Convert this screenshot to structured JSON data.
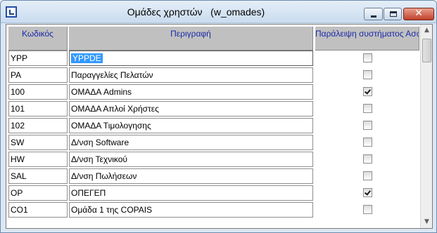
{
  "window": {
    "title": "Ομάδες χρηστών   (w_omades)",
    "close_glyph": "✕"
  },
  "grid": {
    "columns": {
      "code": "Κωδικός",
      "description": "Περιγραφή",
      "skip_security": "Παράλειψη συστήματος Ασφάλειας"
    },
    "rows": [
      {
        "code": "YPP",
        "description": "YPPDE",
        "skip_security": false
      },
      {
        "code": "PA",
        "description": "Παραγγελίες Πελατών",
        "skip_security": false
      },
      {
        "code": "100",
        "description": "ΟΜΑΔΑ Admins",
        "skip_security": true
      },
      {
        "code": "101",
        "description": "ΟΜΑΔΑ Απλοί Χρήστες",
        "skip_security": false
      },
      {
        "code": "102",
        "description": "ΟΜΑΔΑ Τιμολογησης",
        "skip_security": false
      },
      {
        "code": "SW",
        "description": "Δ/νση Software",
        "skip_security": false
      },
      {
        "code": "HW",
        "description": "Δ/νση Τεχνικού",
        "skip_security": false
      },
      {
        "code": "SAL",
        "description": "Δ/νση Πωλήσεων",
        "skip_security": false
      },
      {
        "code": "OP",
        "description": "ΟΠΕΓΕΠ",
        "skip_security": true
      },
      {
        "code": "CO1",
        "description": "Ομάδα 1 της COPAIS",
        "skip_security": false
      }
    ]
  },
  "scrollbar": {
    "up_arrow": "▲",
    "down_arrow": "▼"
  }
}
